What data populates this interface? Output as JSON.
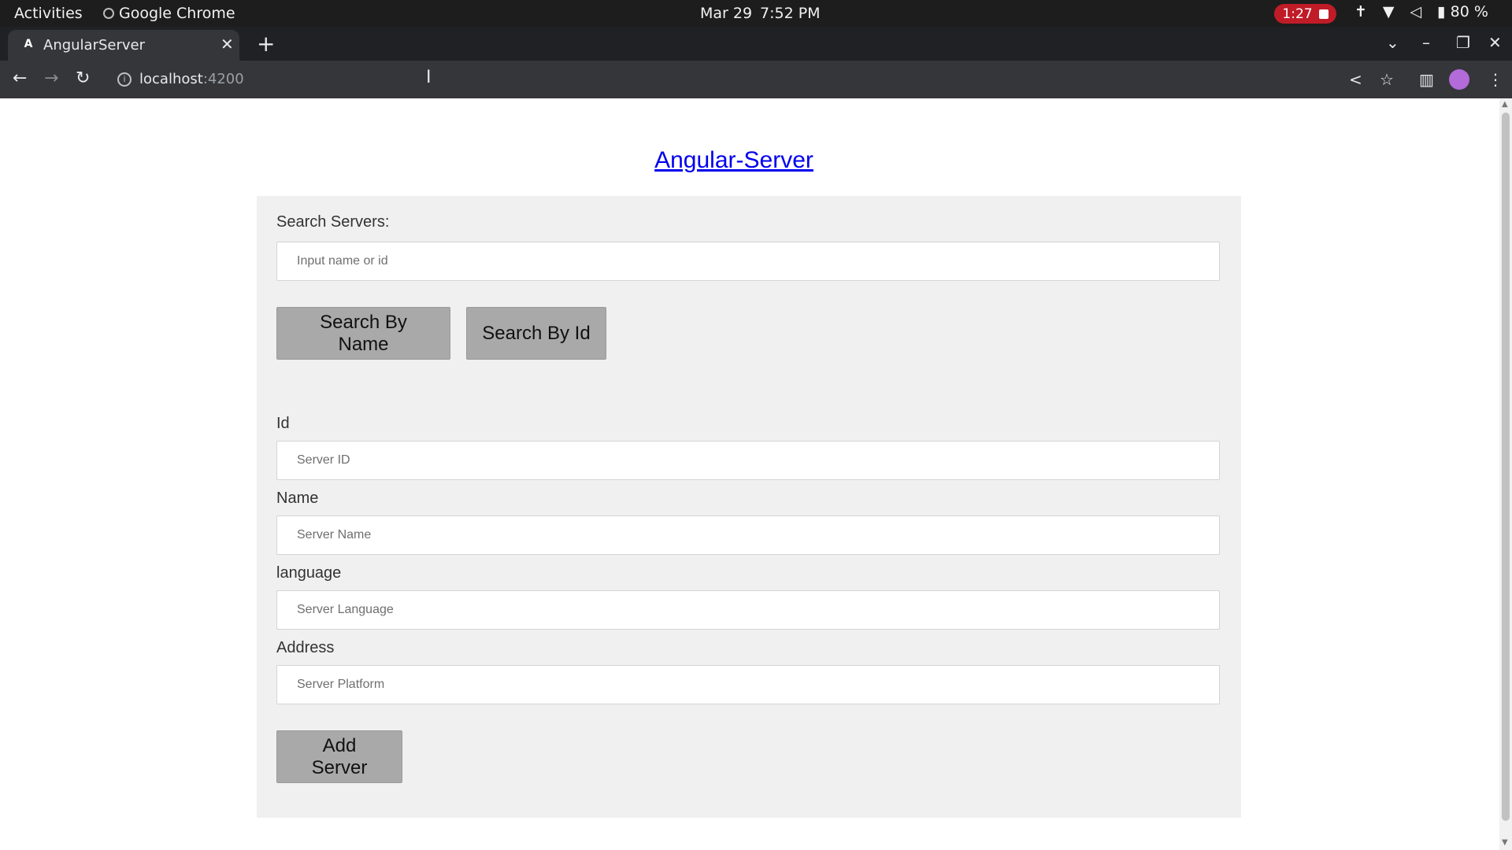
{
  "os_bar": {
    "activities": "Activities",
    "app_name": "Google Chrome",
    "date": "Mar 29",
    "time": "7:52 PM",
    "recording": "1:27",
    "battery": "80 %"
  },
  "browser": {
    "tab_title": "AngularServer",
    "favicon": "A",
    "url_host": "localhost",
    "url_port": ":4200"
  },
  "page": {
    "heading": "Angular-Server",
    "search": {
      "label": "Search Servers:",
      "placeholder": "Input name or id",
      "by_name_button": "Search By Name",
      "by_id_button": "Search By Id"
    },
    "form": {
      "id_label": "Id",
      "id_placeholder": "Server ID",
      "name_label": "Name",
      "name_placeholder": "Server Name",
      "language_label": "language",
      "language_placeholder": "Server Language",
      "address_label": "Address",
      "address_placeholder": "Server Platform",
      "add_button": "Add Server"
    }
  },
  "colors": {
    "link": "#0000ee",
    "panel": "#f0f0f0",
    "button": "#a9a9a9",
    "recording": "#c01c28"
  }
}
